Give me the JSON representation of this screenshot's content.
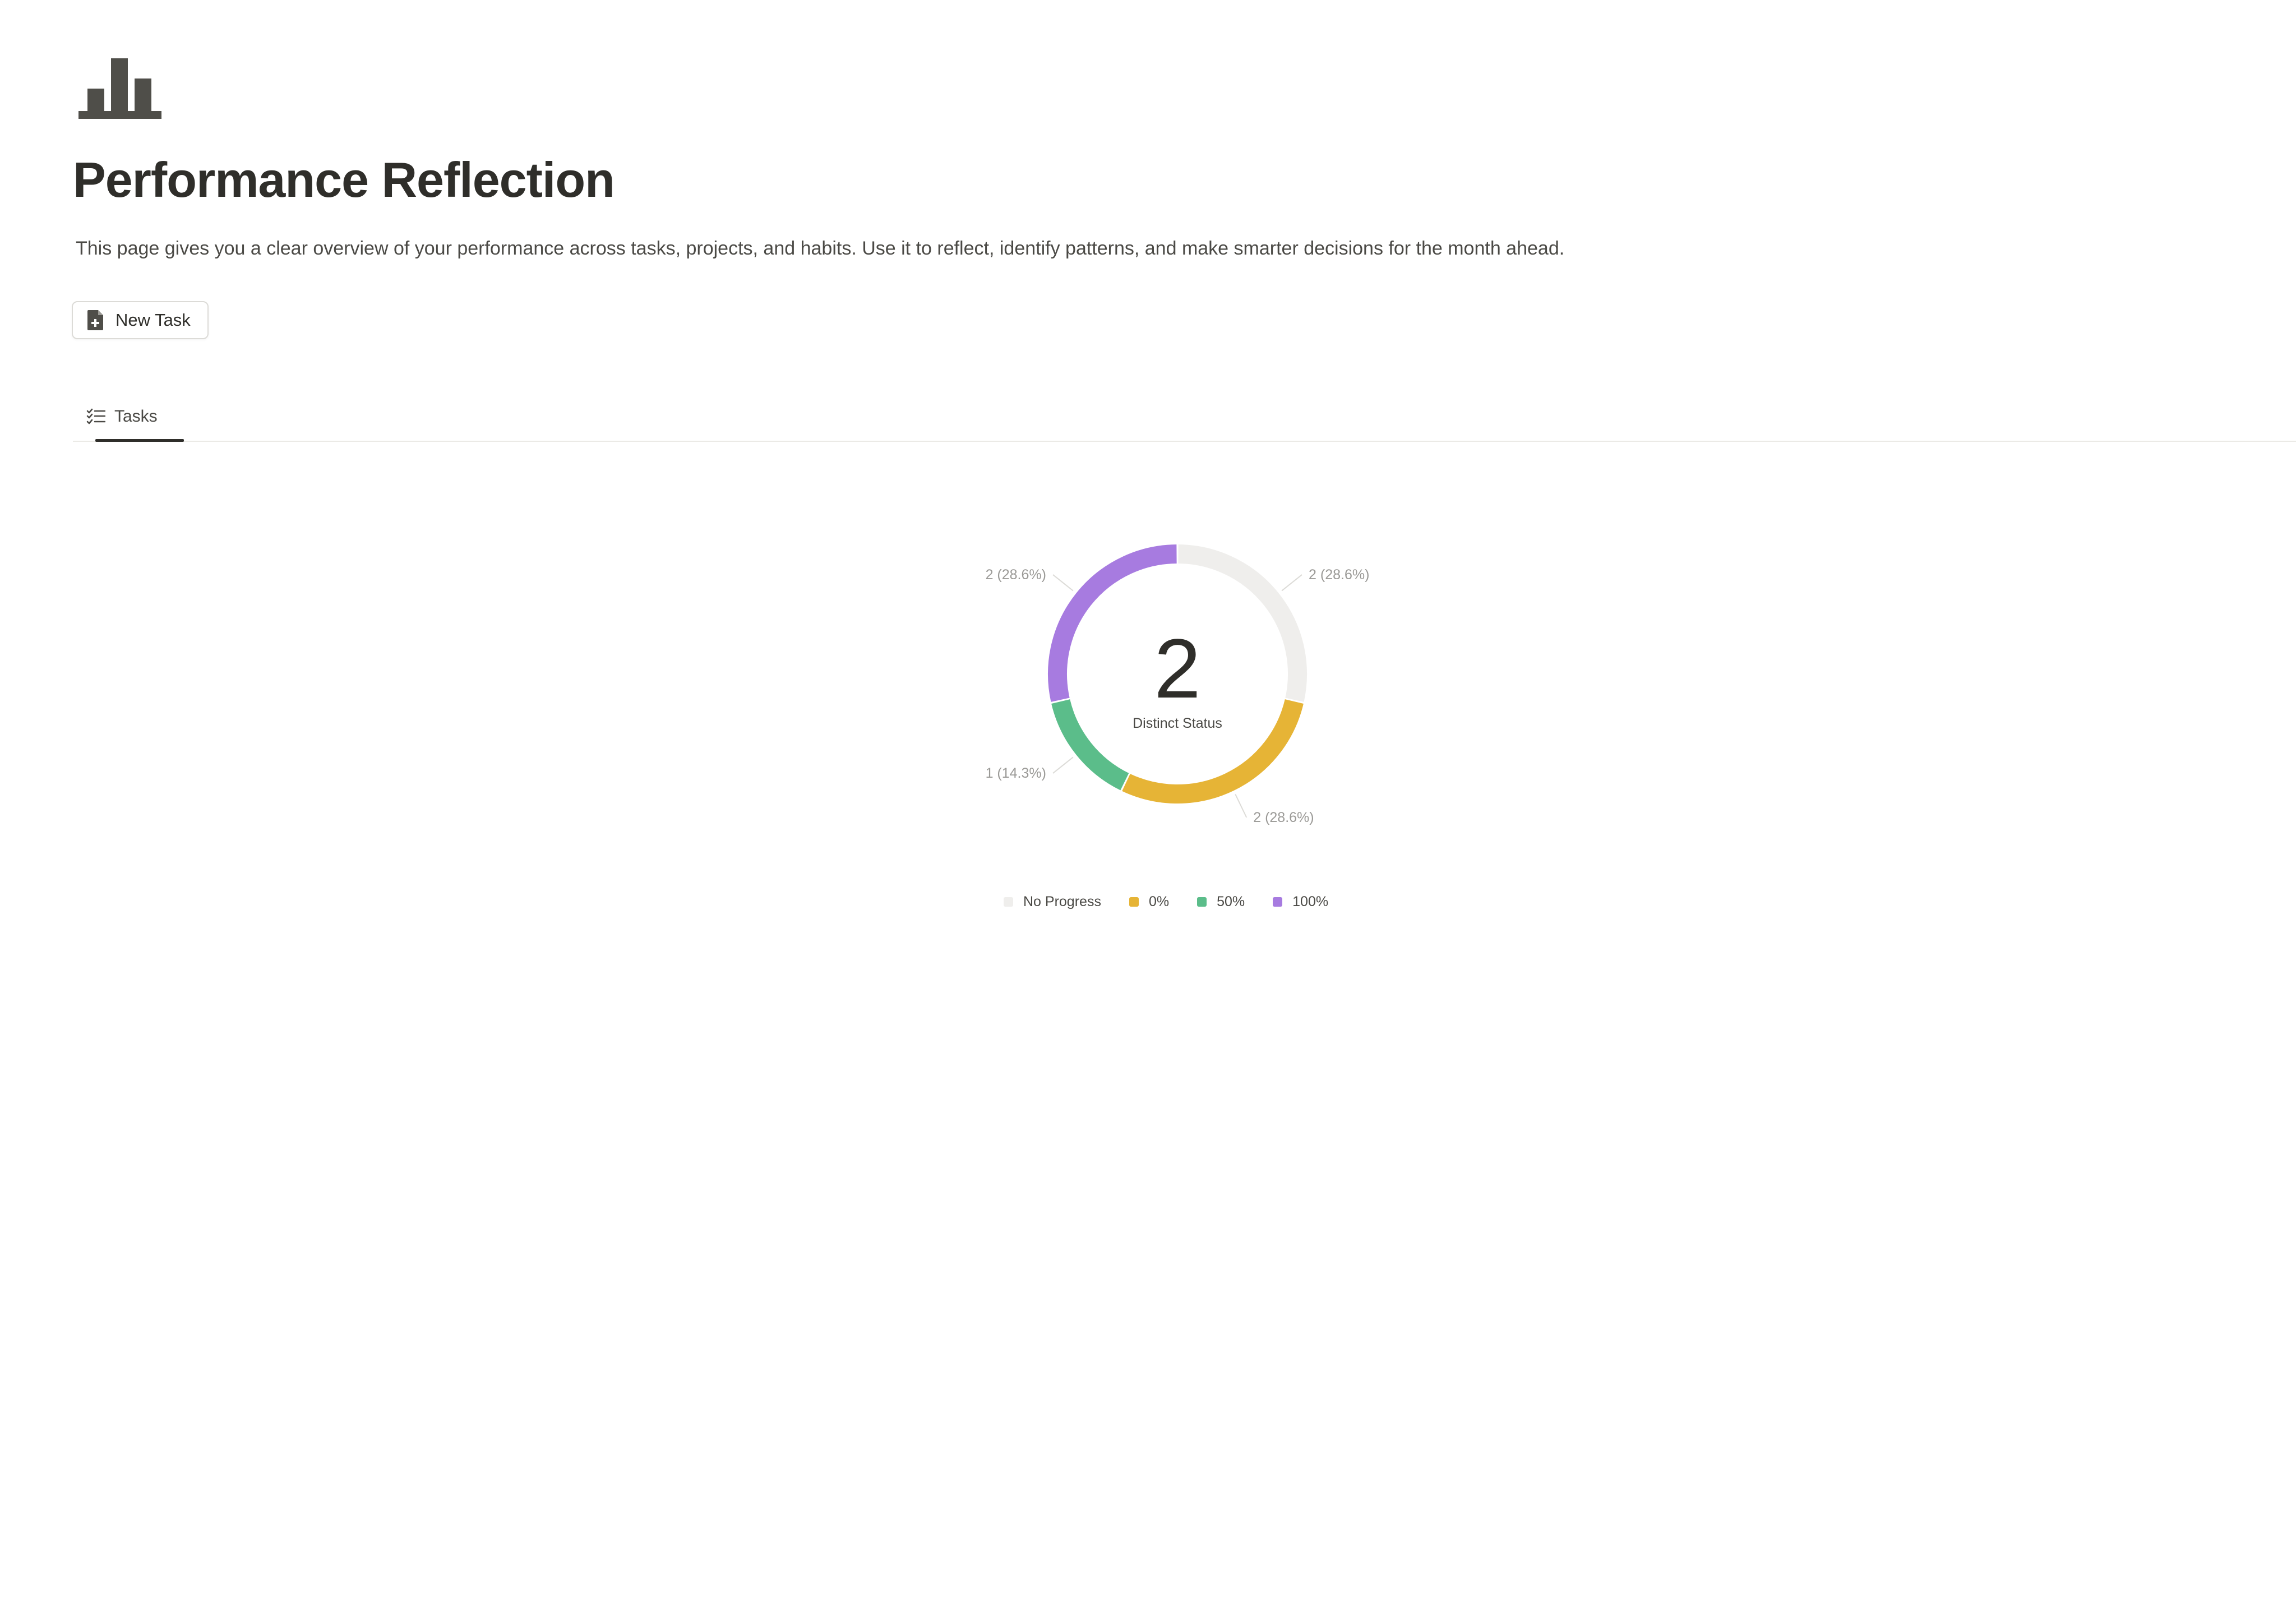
{
  "page": {
    "icon": "bar-chart-icon",
    "title": "Performance Reflection",
    "description": "This page gives you a clear overview of your performance across tasks, projects, and habits. Use it to reflect, identify patterns, and make smarter decisions for the month ahead."
  },
  "actions": {
    "new_task_label": "New Task",
    "new_task_icon": "add-document-icon"
  },
  "tabs": [
    {
      "label": "Tasks",
      "icon": "checklist-icon",
      "active": true
    }
  ],
  "colors": {
    "text": "#37352f",
    "no_progress": "#efeeec",
    "zero": "#e6b436",
    "fifty": "#5bbd8a",
    "hundred": "#a77be0"
  },
  "chart_data": {
    "type": "pie",
    "center_value": "2",
    "center_label": "Distinct Status",
    "legend_position": "bottom",
    "slices": [
      {
        "name": "No Progress",
        "value": 2,
        "percent": 28.6,
        "label": "2 (28.6%)",
        "color": "#efeeec"
      },
      {
        "name": "0%",
        "value": 2,
        "percent": 28.6,
        "label": "2 (28.6%)",
        "color": "#e6b436"
      },
      {
        "name": "50%",
        "value": 1,
        "percent": 14.3,
        "label": "1 (14.3%)",
        "color": "#5bbd8a"
      },
      {
        "name": "100%",
        "value": 2,
        "percent": 28.6,
        "label": "2 (28.6%)",
        "color": "#a77be0"
      }
    ]
  }
}
